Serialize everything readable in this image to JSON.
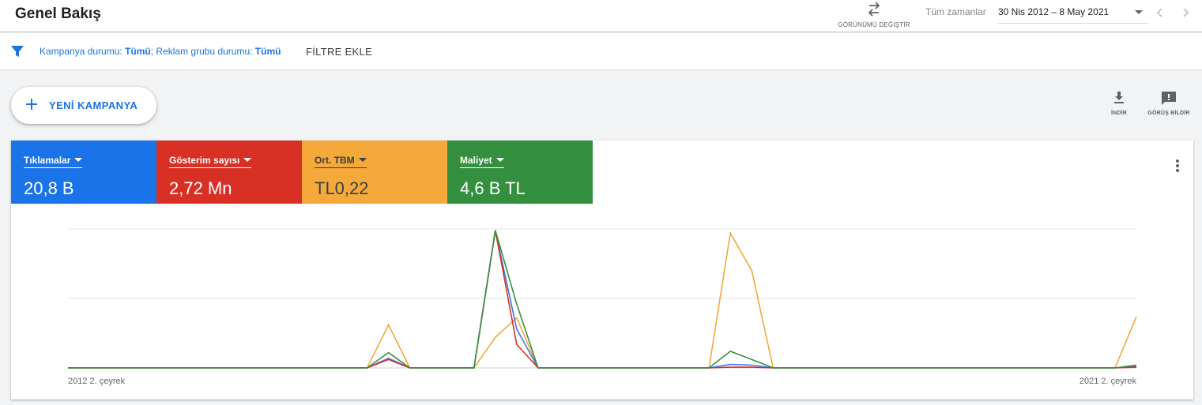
{
  "header": {
    "title": "Genel Bakış",
    "switch_view_label": "GÖRÜNÜMÜ DEĞİŞTİR",
    "date_preset": "Tüm zamanlar",
    "date_range": "30 Nis 2012 – 8 May 2021"
  },
  "filters": {
    "campaign_status_label": "Kampanya durumu: ",
    "campaign_status_value": "Tümü",
    "separator": "; ",
    "adgroup_status_label": "Reklam grubu durumu: ",
    "adgroup_status_value": "Tümü",
    "add_filter_label": "FİLTRE EKLE"
  },
  "toolbar": {
    "new_campaign_label": "YENİ KAMPANYA",
    "download_label": "İNDİR",
    "feedback_label": "GÖRÜŞ BİLDİR"
  },
  "metrics": [
    {
      "label": "Tıklamalar",
      "value": "20,8 B",
      "bg": "#1a73e8",
      "fg": "#ffffff"
    },
    {
      "label": "Gösterim sayısı",
      "value": "2,72 Mn",
      "bg": "#d93025",
      "fg": "#ffffff"
    },
    {
      "label": "Ort. TBM",
      "value": "TL0,22",
      "bg": "#f4a93a",
      "fg": "#3c4043"
    },
    {
      "label": "Maliyet",
      "value": "4,6 B TL",
      "bg": "#34903f",
      "fg": "#ffffff"
    }
  ],
  "colors": {
    "accent": "#1a73e8",
    "clicks": "#3b78e7",
    "impressions": "#d93025",
    "avg_cpc": "#f4a93a",
    "cost": "#34903f"
  },
  "chart_data": {
    "type": "line",
    "x_tick_labels": [
      "2012 2. çeyrek",
      "2021 2. çeyrek"
    ],
    "y_normalized_range": [
      0,
      1
    ],
    "gridlines": 3,
    "series": [
      {
        "name": "Ort. TBM",
        "color": "#f4a93a",
        "values": [
          0,
          0,
          0,
          0,
          0,
          0,
          0,
          0,
          0,
          0,
          0,
          0,
          0,
          0,
          0,
          0.31,
          0,
          0,
          0,
          0,
          0.22,
          0.36,
          0,
          0,
          0,
          0,
          0,
          0,
          0,
          0,
          0,
          0.97,
          0.7,
          0,
          0,
          0,
          0,
          0,
          0,
          0,
          0,
          0,
          0,
          0,
          0,
          0,
          0,
          0,
          0,
          0,
          0.37
        ]
      },
      {
        "name": "Tıklamalar",
        "color": "#3b78e7",
        "values": [
          0,
          0,
          0,
          0,
          0,
          0,
          0,
          0,
          0,
          0,
          0,
          0,
          0,
          0,
          0,
          0.07,
          0,
          0,
          0,
          0,
          0.99,
          0.28,
          0,
          0,
          0,
          0,
          0,
          0,
          0,
          0,
          0,
          0.025,
          0.02,
          0,
          0,
          0,
          0,
          0,
          0,
          0,
          0,
          0,
          0,
          0,
          0,
          0,
          0,
          0,
          0,
          0,
          0.01
        ]
      },
      {
        "name": "Gösterim sayısı",
        "color": "#d93025",
        "values": [
          0,
          0,
          0,
          0,
          0,
          0,
          0,
          0,
          0,
          0,
          0,
          0,
          0,
          0,
          0,
          0.06,
          0,
          0,
          0,
          0,
          0.99,
          0.17,
          0,
          0,
          0,
          0,
          0,
          0,
          0,
          0,
          0,
          0.005,
          0.005,
          0,
          0,
          0,
          0,
          0,
          0,
          0,
          0,
          0,
          0,
          0,
          0,
          0,
          0,
          0,
          0,
          0,
          0.005
        ]
      },
      {
        "name": "Maliyet",
        "color": "#34903f",
        "values": [
          0,
          0,
          0,
          0,
          0,
          0,
          0,
          0,
          0,
          0,
          0,
          0,
          0,
          0,
          0,
          0.11,
          0,
          0,
          0,
          0,
          0.99,
          0.46,
          0,
          0,
          0,
          0,
          0,
          0,
          0,
          0,
          0,
          0.12,
          0.06,
          0,
          0,
          0,
          0,
          0,
          0,
          0,
          0,
          0,
          0,
          0,
          0,
          0,
          0,
          0,
          0,
          0,
          0.02
        ]
      }
    ]
  }
}
